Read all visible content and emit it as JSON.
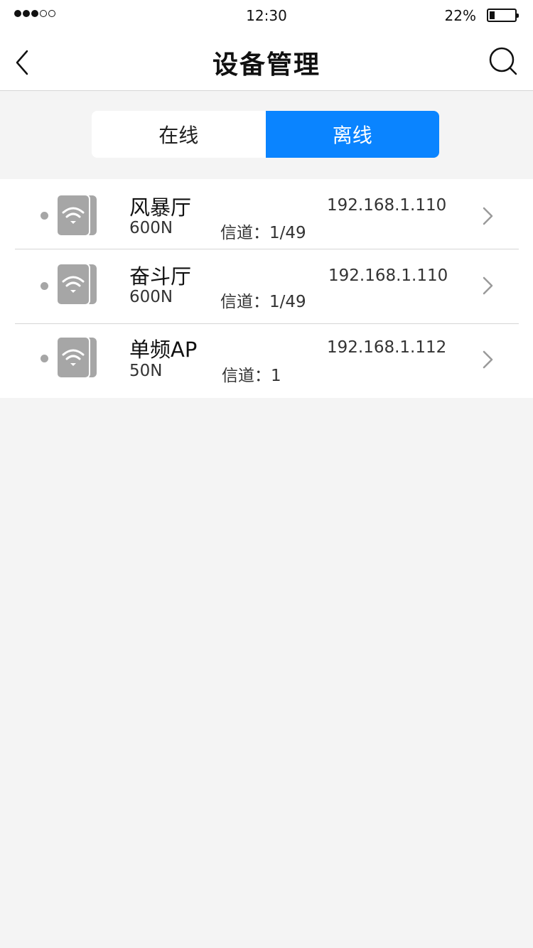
{
  "status_bar": {
    "signal": [
      true,
      true,
      true,
      false,
      false
    ],
    "time": "12:30",
    "battery_text": "22%",
    "battery_level": 0.22
  },
  "nav": {
    "title": "设备管理",
    "back_icon": "chevron-left-icon",
    "search_icon": "search-icon"
  },
  "segment": {
    "online_label": "在线",
    "offline_label": "离线",
    "selected": "offline",
    "accent_color": "#0a84ff"
  },
  "devices": [
    {
      "name": "风暴厅",
      "model": "600N",
      "channel": "信道：1/49",
      "ip": "192.168.1.110",
      "status": "offline"
    },
    {
      "name": "奋斗厅",
      "model": "600N",
      "channel": "信道：1/49",
      "ip": "192.168.1.110",
      "status": "offline"
    },
    {
      "name": "单频AP",
      "model": "50N",
      "channel": "信道：1",
      "ip": "192.168.1.112",
      "status": "offline"
    }
  ],
  "colors": {
    "offline_dot": "#a6a6a6",
    "device_icon": "#a6a6a6",
    "background": "#f4f4f4"
  }
}
